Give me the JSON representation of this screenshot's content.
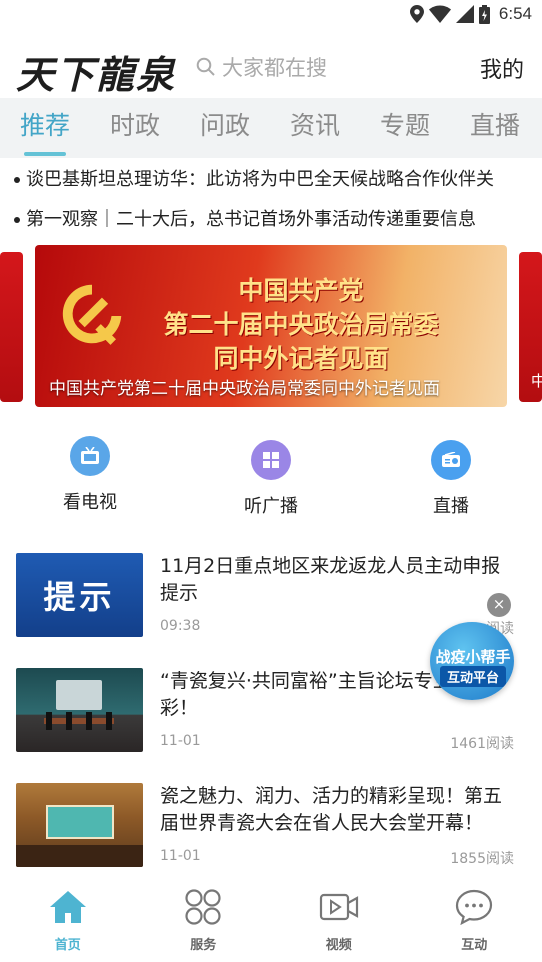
{
  "status_bar": {
    "time": "6:54",
    "icons": [
      "location-icon",
      "wifi-icon",
      "signal-icon",
      "battery-icon"
    ]
  },
  "header": {
    "logo": "天下龍泉",
    "search_placeholder": "大家都在搜",
    "mine": "我的"
  },
  "tabs": [
    {
      "label": "推荐",
      "active": true
    },
    {
      "label": "时政",
      "active": false
    },
    {
      "label": "问政",
      "active": false
    },
    {
      "label": "资讯",
      "active": false
    },
    {
      "label": "专题",
      "active": false
    },
    {
      "label": "直播",
      "active": false
    }
  ],
  "headlines": [
    "谈巴基斯坦总理访华：此访将为中巴全天候战略合作伙伴关",
    "第一观察｜二十大后，总书记首场外事活动传递重要信息"
  ],
  "banner": {
    "line1": "中国共产党",
    "line2": "第二十届中央政治局常委",
    "line3": "同中外记者见面",
    "caption": "中国共产党第二十届中央政治局常委同中外记者见面",
    "side_caption": "中"
  },
  "quick_entries": [
    {
      "label": "看电视",
      "icon": "tv-icon",
      "color": "#5aa6e8"
    },
    {
      "label": "听广播",
      "icon": "grid-icon",
      "color": "#9a86e6"
    },
    {
      "label": "直播",
      "icon": "radio-icon",
      "color": "#4aa0ef"
    }
  ],
  "news": [
    {
      "title": "11月2日重点地区来龙返龙人员主动申报提示",
      "time": "09:38",
      "reads": "阅读",
      "thumb_text": "提示"
    },
    {
      "title": "“青瓷复兴·共同富裕”主旨论坛专业、精彩！",
      "time": "11-01",
      "reads": "1461阅读"
    },
    {
      "title": "瓷之魅力、润力、活力的精彩呈现！第五届世界青瓷大会在省人民大会堂开幕！",
      "time": "11-01",
      "reads": "1855阅读"
    }
  ],
  "floating_widget": {
    "line1": "战疫小帮手",
    "line2": "互动平台",
    "close": "×"
  },
  "bottom_nav": [
    {
      "label": "首页",
      "icon": "home-icon",
      "active": true
    },
    {
      "label": "服务",
      "icon": "services-icon",
      "active": false
    },
    {
      "label": "视频",
      "icon": "video-icon",
      "active": false
    },
    {
      "label": "互动",
      "icon": "chat-icon",
      "active": false
    }
  ],
  "colors": {
    "accent": "#43a5c7",
    "tab_bg": "#f1f3f4",
    "banner_red": "#c8131a"
  }
}
